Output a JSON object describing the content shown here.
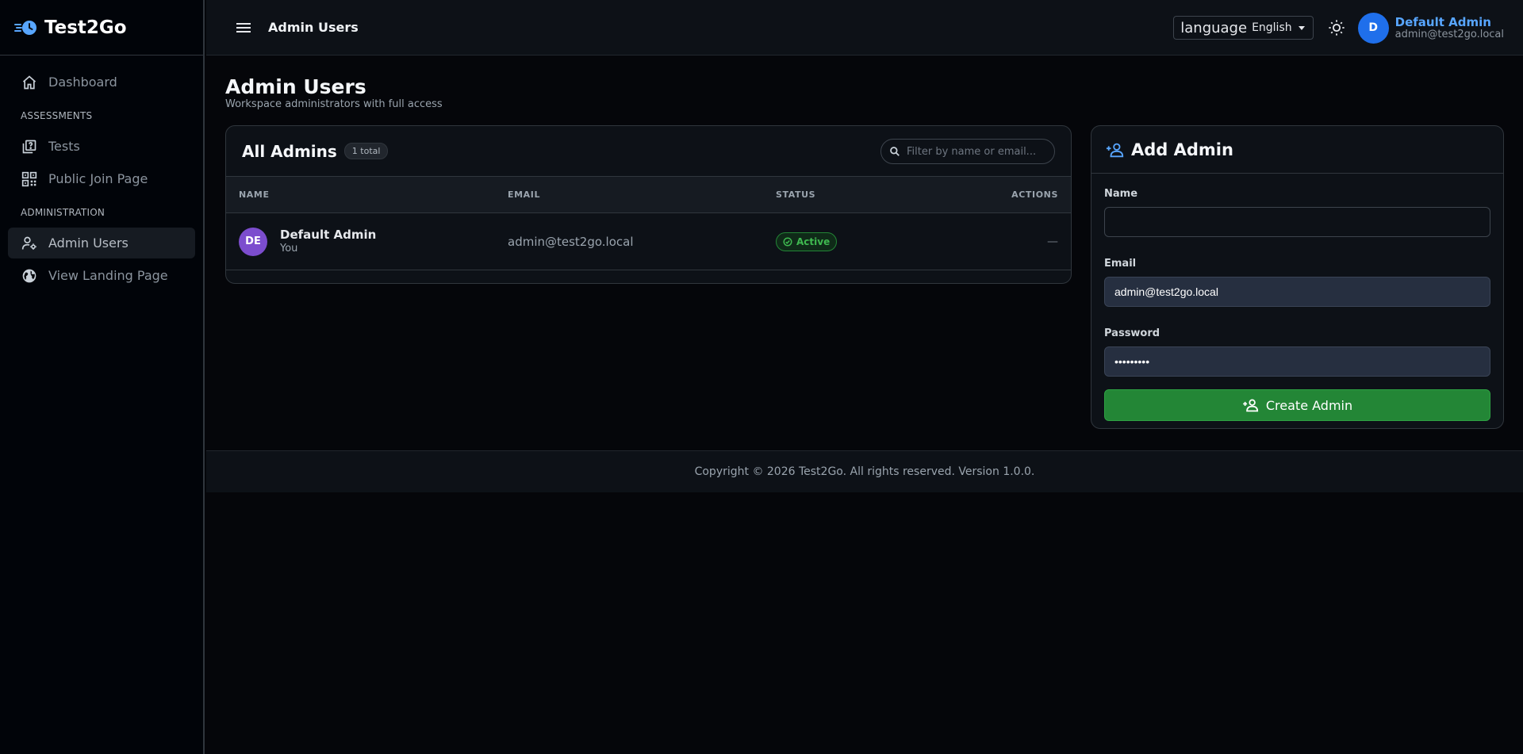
{
  "brand": {
    "name": "Test2Go",
    "icon": "clock-logo-icon",
    "accent": "#58a6ff"
  },
  "sidebar": {
    "items": [
      {
        "label": "Dashboard",
        "icon": "home-icon"
      },
      {
        "label": "Tests",
        "icon": "quiz-icon"
      },
      {
        "label": "Public Join Page",
        "icon": "qr-code-icon"
      },
      {
        "label": "Admin Users",
        "icon": "user-gear-icon",
        "active": true
      },
      {
        "label": "View Landing Page",
        "icon": "globe-icon"
      }
    ],
    "sections": {
      "assessments": "ASSESSMENTS",
      "administration": "ADMINISTRATION"
    }
  },
  "topbar": {
    "title": "Admin Users",
    "language_label": "language",
    "language_value": "English",
    "user_initial": "D",
    "user_name": "Default Admin",
    "user_email": "admin@test2go.local"
  },
  "page": {
    "title": "Admin Users",
    "subtitle": "Workspace administrators with full access"
  },
  "admins_card": {
    "title": "All Admins",
    "total_badge": "1 total",
    "search_placeholder": "Filter by name or email...",
    "columns": [
      "NAME",
      "EMAIL",
      "STATUS",
      "ACTIONS"
    ],
    "rows": [
      {
        "initials": "DE",
        "name": "Default Admin",
        "sub": "You",
        "email": "admin@test2go.local",
        "status": "Active",
        "actions": "—"
      }
    ]
  },
  "add_card": {
    "title": "Add Admin",
    "name_label": "Name",
    "name_value": "",
    "email_label": "Email",
    "email_value": "admin@test2go.local",
    "password_label": "Password",
    "password_value": "password1",
    "submit_label": "Create Admin"
  },
  "footer": {
    "text": "Copyright © 2026 Test2Go. All rights reserved. Version 1.0.0."
  },
  "colors": {
    "success": "#238636",
    "avatar_purple": "#7c4dce",
    "avatar_blue": "#1f6feb"
  }
}
